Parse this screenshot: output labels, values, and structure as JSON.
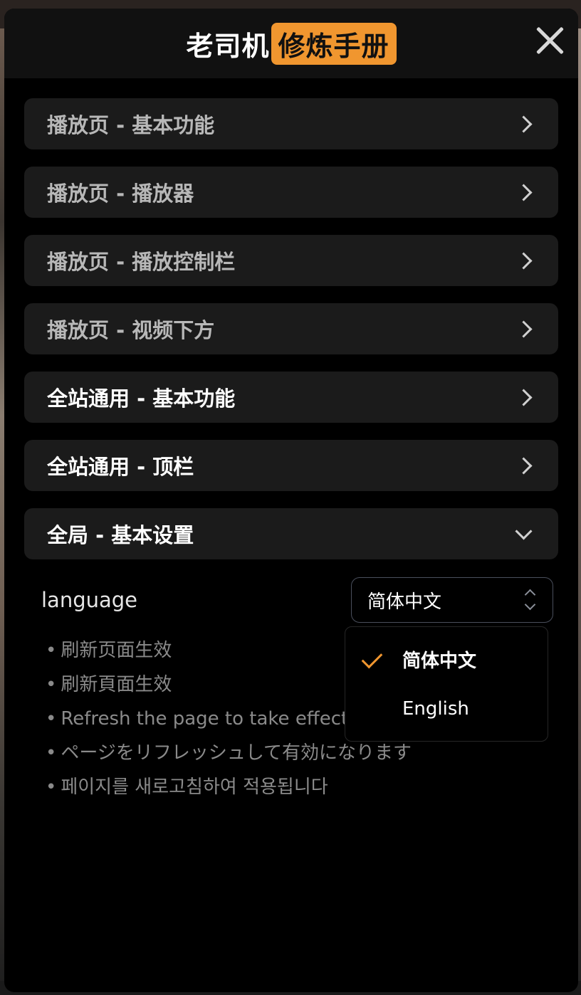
{
  "header": {
    "title_part1": "老司机",
    "title_part2": "修炼手册"
  },
  "sections": [
    {
      "label": "播放页 - 基本功能",
      "style": "dim",
      "state": "collapsed"
    },
    {
      "label": "播放页 - 播放器",
      "style": "dim",
      "state": "collapsed"
    },
    {
      "label": "播放页 - 播放控制栏",
      "style": "dim",
      "state": "collapsed"
    },
    {
      "label": "播放页 - 视频下方",
      "style": "dim",
      "state": "collapsed"
    },
    {
      "label": "全站通用 - 基本功能",
      "style": "bright",
      "state": "collapsed"
    },
    {
      "label": "全站通用 - 顶栏",
      "style": "bright",
      "state": "collapsed"
    },
    {
      "label": "全局 - 基本设置",
      "style": "bright",
      "state": "expanded"
    }
  ],
  "language_setting": {
    "label": "language",
    "selected": "简体中文",
    "notes": [
      "刷新页面生效",
      "刷新頁面生效",
      "Refresh the page to take effect",
      "ページをリフレッシュして有効になります",
      "페이지를 새로고침하여 적용됩니다"
    ],
    "options": [
      {
        "label": "简体中文",
        "checked": true
      },
      {
        "label": "English",
        "checked": false
      }
    ]
  },
  "colors": {
    "accent": "#f0962f",
    "panel_bg": "#000000",
    "header_bg": "#111111",
    "row_bg": "#1b1b1b"
  },
  "icons": {
    "close": "close-icon",
    "chevron_right": "chevron-right-icon",
    "chevron_down": "chevron-down-icon",
    "select_updown": "updown-icon",
    "check": "check-icon"
  }
}
